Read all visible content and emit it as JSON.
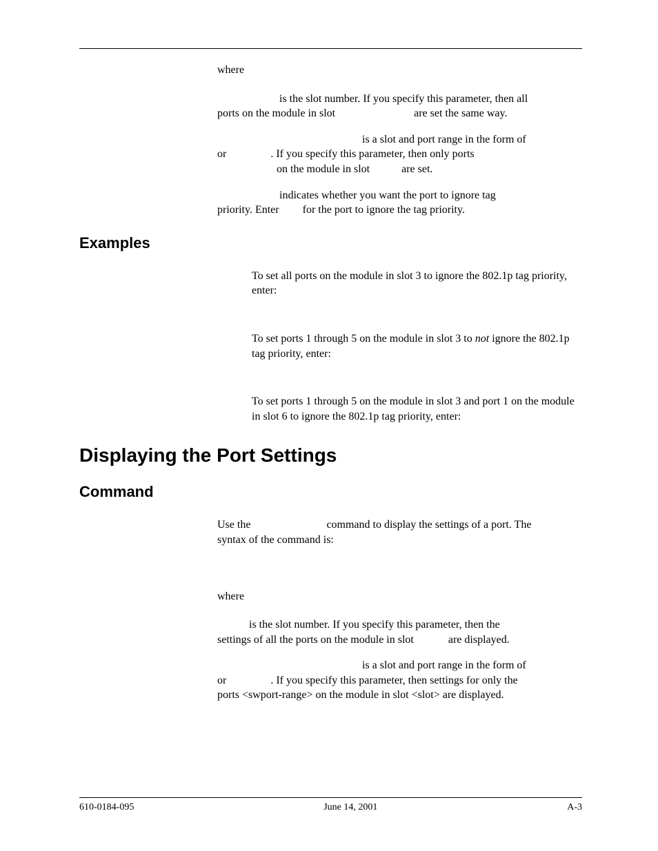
{
  "top": {
    "where": "where",
    "p1_a": "is the slot number. If you specify this parameter, then all",
    "p1_b": "ports on the module in slot",
    "p1_c": "are set the same way.",
    "p2_a": "is a slot and port range in the form of",
    "p2_or": "or",
    "p2_b": ". If you specify this parameter, then only ports",
    "p2_c": "on the module in slot",
    "p2_d": "are set.",
    "p3_a": "indicates whether you want the port to ignore tag",
    "p3_b": "priority. Enter",
    "p3_c": "for the port to ignore the tag priority."
  },
  "examples": {
    "heading": "Examples",
    "e1": "To set all ports on the module in slot 3 to ignore the 802.1p tag priority, enter:",
    "e2a": "To set ports 1 through 5 on the module in slot 3 to ",
    "e2b": "not",
    "e2c": " ignore the 802.1p tag priority, enter:",
    "e3": "To set ports 1 through 5 on the module in slot 3 and port 1 on the module in slot 6 to ignore the 802.1p tag priority, enter:"
  },
  "display": {
    "heading": "Displaying the Port Settings",
    "command": "Command",
    "p1a": "Use the",
    "p1b": "command to display the settings of a port. The",
    "p1c": "syntax of the command is:",
    "where": "where",
    "p2a": "is the slot number. If you specify this parameter, then the",
    "p2b": "settings of all the ports on the module in slot",
    "p2c": "are displayed.",
    "p3a": "is a slot and port range in the form of",
    "p3or": "or",
    "p3b": ". If you specify this parameter, then settings for only the",
    "p3c": "ports <swport-range> on the module in slot <slot> are displayed."
  },
  "footer": {
    "left": "610-0184-095",
    "center": "June 14, 2001",
    "right": "A-3"
  }
}
